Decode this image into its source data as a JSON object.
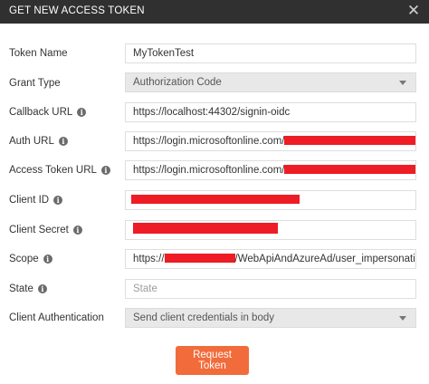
{
  "dialog": {
    "title": "GET NEW ACCESS TOKEN",
    "close_glyph": "✕"
  },
  "fields": {
    "token_name": {
      "label": "Token Name",
      "value": "MyTokenTest"
    },
    "grant_type": {
      "label": "Grant Type",
      "value": "Authorization Code"
    },
    "callback_url": {
      "label": "Callback URL",
      "value": "https://localhost:44302/signin-oidc"
    },
    "auth_url": {
      "label": "Auth URL",
      "value_prefix": "https://login.microsoftonline.com/"
    },
    "access_token_url": {
      "label": "Access Token URL",
      "value_prefix": "https://login.microsoftonline.com/"
    },
    "client_id": {
      "label": "Client ID"
    },
    "client_secret": {
      "label": "Client Secret"
    },
    "scope": {
      "label": "Scope",
      "value_prefix": "https://",
      "value_suffix": "/WebApiAndAzureAd/user_impersonation"
    },
    "state": {
      "label": "State",
      "placeholder": "State"
    },
    "client_authentication": {
      "label": "Client Authentication",
      "value": "Send client credentials in body"
    }
  },
  "info_glyph": "i",
  "request_button": {
    "label": "Request Token"
  },
  "colors": {
    "title_bar": "#303030",
    "accent_button": "#f26b3a",
    "redaction": "#ee1c24"
  }
}
